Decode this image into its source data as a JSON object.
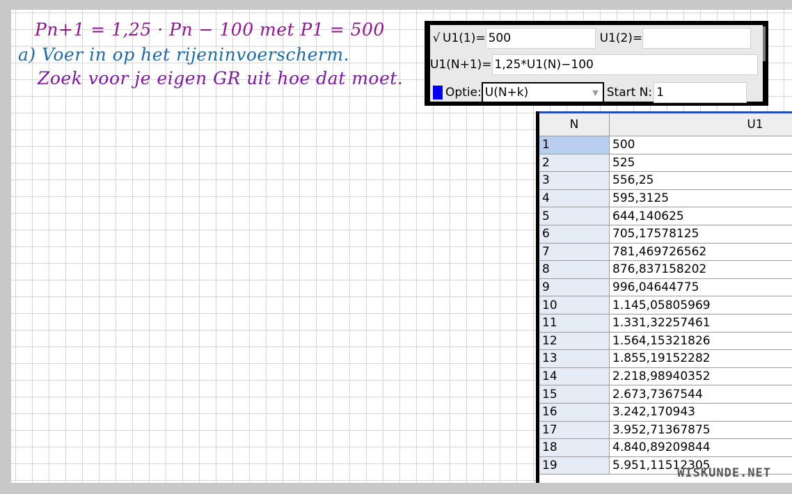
{
  "handwriting": {
    "equation": "Pn+1 = 1,25 · Pn − 100   met  P1 = 500",
    "line_a": "a) Voer in op het rijeninvoerscherm.",
    "line_b": "Zoek voor je eigen GR uit hoe dat moet."
  },
  "sequence_editor": {
    "check_mark": "√",
    "u1_first_label": "U1(1)=",
    "u1_first_value": "500",
    "u1_second_label": "U1(2)=",
    "u1_second_value": "",
    "recursion_label": "U1(N+1)=",
    "recursion_value": "1,25*U1(N)−100",
    "option_label": "Optie:",
    "option_value": "U(N+k)",
    "start_label": "Start N:",
    "start_value": "1",
    "color_swatch": "#0000ee"
  },
  "table": {
    "headers": [
      "N",
      "U1"
    ],
    "rows": [
      {
        "n": "1",
        "u": "500"
      },
      {
        "n": "2",
        "u": "525"
      },
      {
        "n": "3",
        "u": "556,25"
      },
      {
        "n": "4",
        "u": "595,3125"
      },
      {
        "n": "5",
        "u": "644,140625"
      },
      {
        "n": "6",
        "u": "705,17578125"
      },
      {
        "n": "7",
        "u": "781,469726562"
      },
      {
        "n": "8",
        "u": "876,837158202"
      },
      {
        "n": "9",
        "u": "996,04644775"
      },
      {
        "n": "10",
        "u": "1.145,05805969"
      },
      {
        "n": "11",
        "u": "1.331,32257461"
      },
      {
        "n": "12",
        "u": "1.564,15321826"
      },
      {
        "n": "13",
        "u": "1.855,19152282"
      },
      {
        "n": "14",
        "u": "2.218,98940352"
      },
      {
        "n": "15",
        "u": "2.673,7367544"
      },
      {
        "n": "16",
        "u": "3.242,170943"
      },
      {
        "n": "17",
        "u": "3.952,71367875"
      },
      {
        "n": "18",
        "u": "4.840,89209844"
      },
      {
        "n": "19",
        "u": "5.951,11512305"
      }
    ]
  },
  "watermark": "WISKUNDE.NET"
}
